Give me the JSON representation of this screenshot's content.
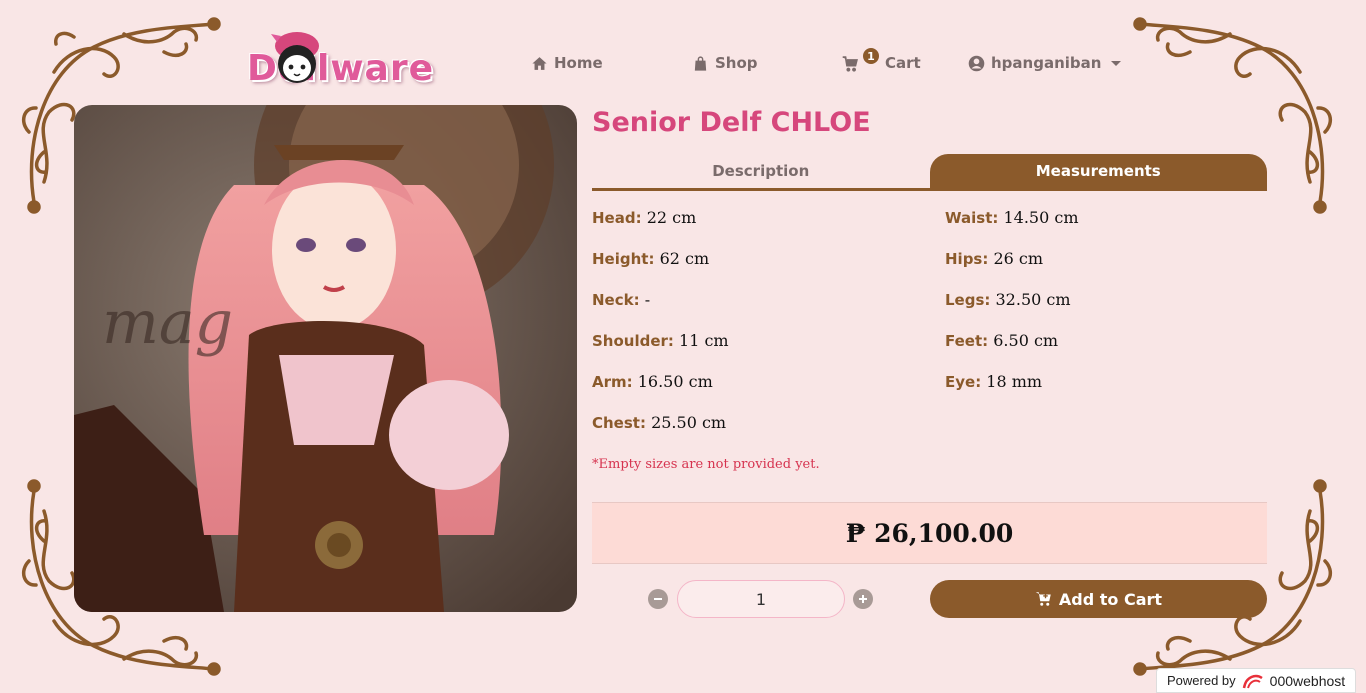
{
  "brand": {
    "logo_text": "Dollware"
  },
  "nav": {
    "home": "Home",
    "shop": "Shop",
    "cart": "Cart",
    "cart_count": "1",
    "user": "hpanganiban"
  },
  "product": {
    "title": "Senior Delf CHLOE",
    "tabs": {
      "description": "Description",
      "measurements": "Measurements"
    },
    "measurements_left": [
      {
        "key": "Head:",
        "value": "22 cm"
      },
      {
        "key": "Height:",
        "value": "62 cm"
      },
      {
        "key": "Neck:",
        "value": "-"
      },
      {
        "key": "Shoulder:",
        "value": "11 cm"
      },
      {
        "key": "Arm:",
        "value": "16.50 cm"
      },
      {
        "key": "Chest:",
        "value": "25.50 cm"
      }
    ],
    "measurements_right": [
      {
        "key": "Waist:",
        "value": "14.50 cm"
      },
      {
        "key": "Hips:",
        "value": "26 cm"
      },
      {
        "key": "Legs:",
        "value": "32.50 cm"
      },
      {
        "key": "Feet:",
        "value": "6.50 cm"
      },
      {
        "key": "Eye:",
        "value": "18 mm"
      }
    ],
    "note": "*Empty sizes are not provided yet.",
    "price": "₱ 26,100.00",
    "quantity": "1",
    "add_to_cart": "Add to Cart"
  },
  "footer": {
    "powered_by": "Powered by",
    "host": "000webhost"
  },
  "colors": {
    "accent": "#8b5a2b",
    "title": "#d6477c",
    "background": "#f9e6e6",
    "price_bg": "#fddbd6",
    "note": "#d6334f"
  }
}
